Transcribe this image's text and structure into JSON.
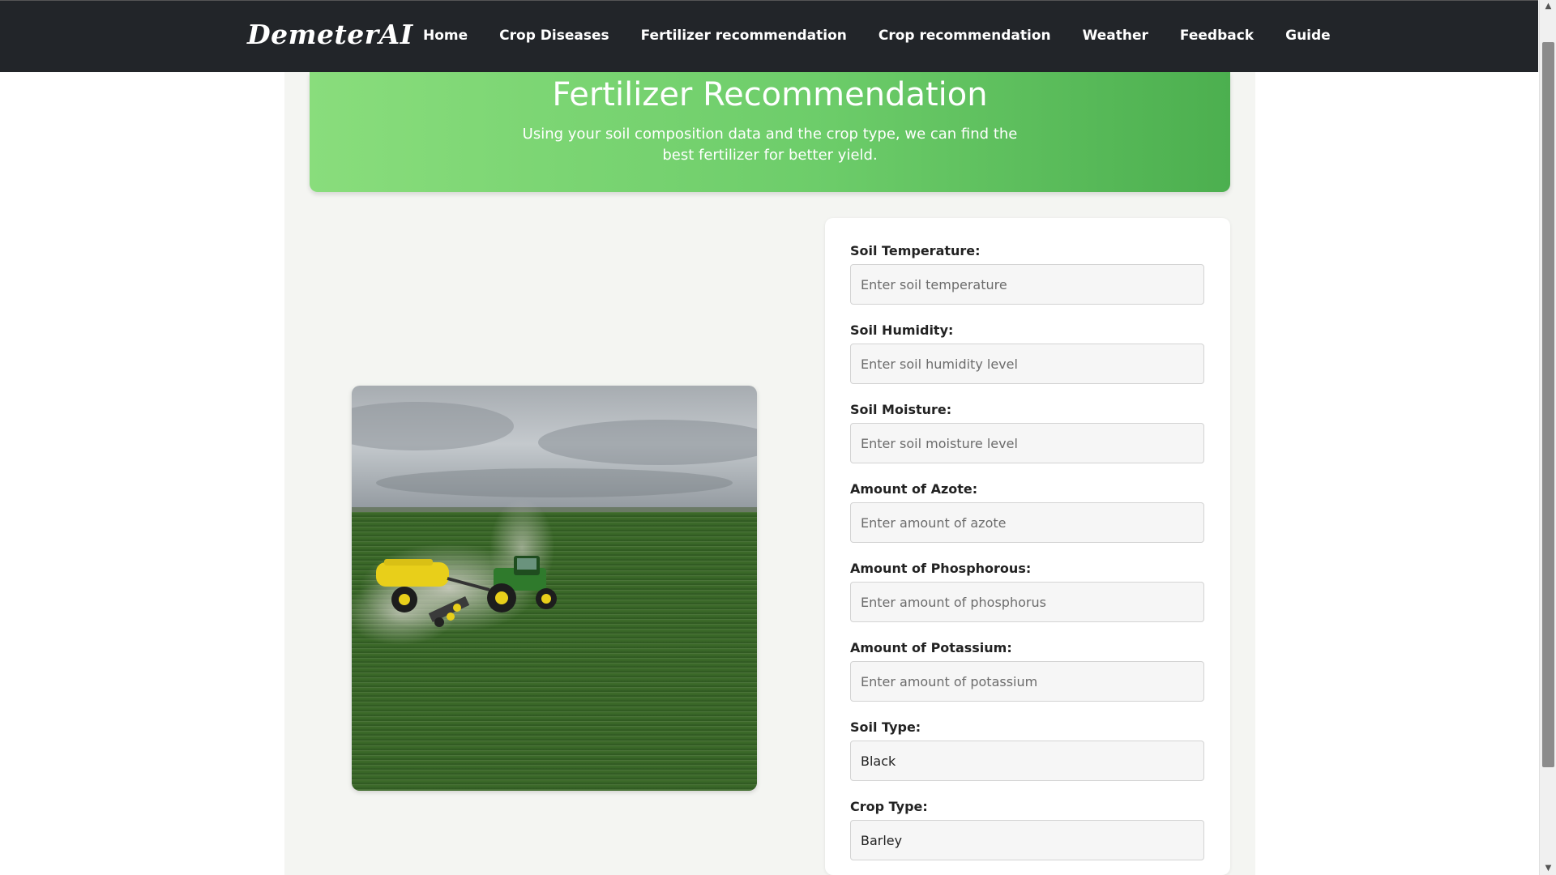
{
  "brand": "DemeterAI",
  "nav": [
    {
      "label": "Home"
    },
    {
      "label": "Crop Diseases"
    },
    {
      "label": "Fertilizer recommendation"
    },
    {
      "label": "Crop recommendation"
    },
    {
      "label": "Weather"
    },
    {
      "label": "Feedback"
    },
    {
      "label": "Guide"
    }
  ],
  "hero": {
    "title": "Fertilizer Recommendation",
    "subtitle": "Using your soil composition data and the crop type, we can find the best fertilizer for better yield."
  },
  "form": {
    "fields": [
      {
        "label": "Soil Temperature:",
        "placeholder": "Enter soil temperature",
        "value": ""
      },
      {
        "label": "Soil Humidity:",
        "placeholder": "Enter soil humidity level",
        "value": ""
      },
      {
        "label": "Soil Moisture:",
        "placeholder": "Enter soil moisture level",
        "value": ""
      },
      {
        "label": "Amount of Azote:",
        "placeholder": "Enter amount of azote",
        "value": ""
      },
      {
        "label": "Amount of Phosphorous:",
        "placeholder": "Enter amount of phosphorus",
        "value": ""
      },
      {
        "label": "Amount of Potassium:",
        "placeholder": "Enter amount of potassium",
        "value": ""
      },
      {
        "label": "Soil Type:",
        "placeholder": "",
        "value": "Black"
      },
      {
        "label": "Crop Type:",
        "placeholder": "",
        "value": "Barley"
      }
    ]
  },
  "colors": {
    "navbar": "#222529",
    "hero_start": "#89dd7c",
    "hero_end": "#4caf4f",
    "page_bg": "#f4f5f2"
  }
}
